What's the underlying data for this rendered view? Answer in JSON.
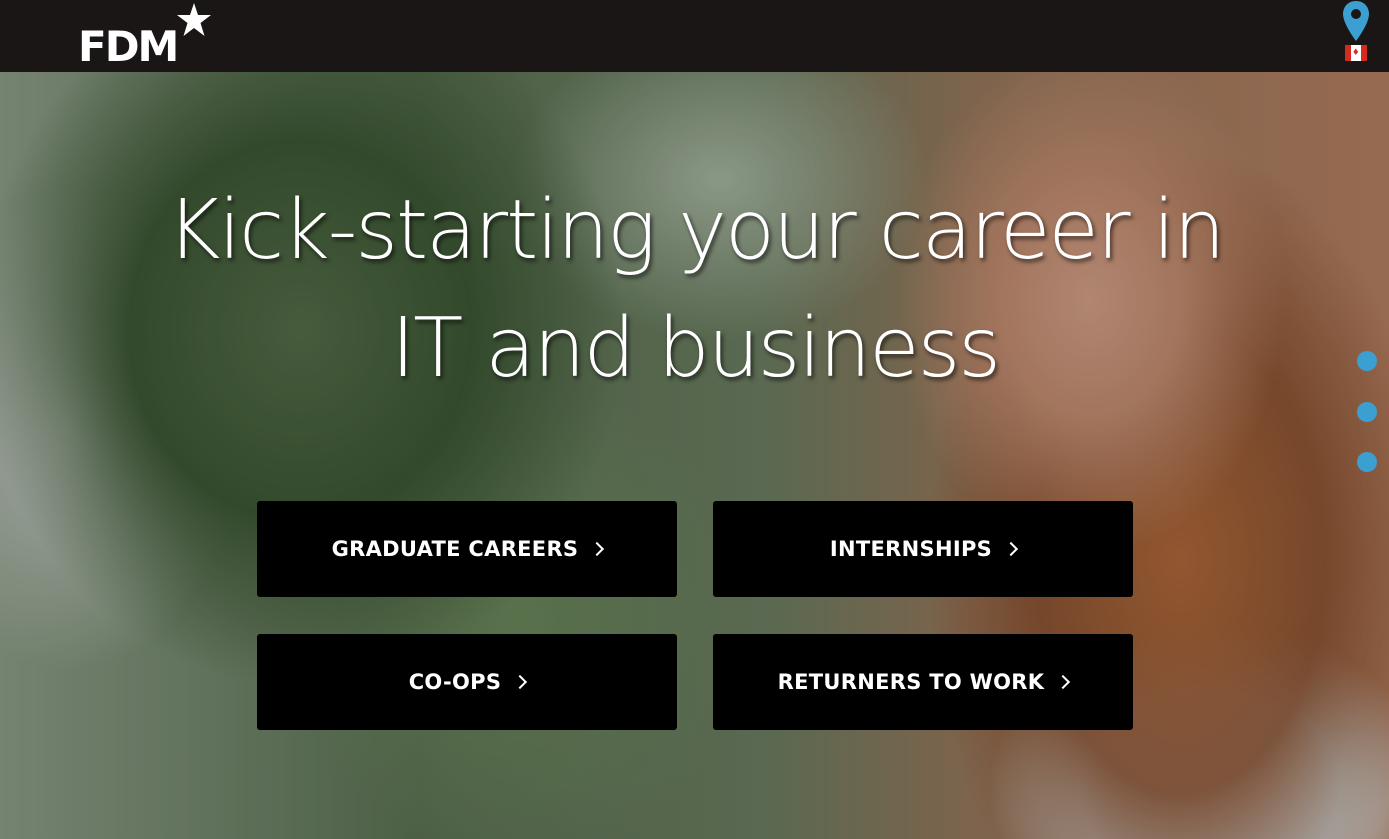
{
  "header": {
    "logo_text": "FDM",
    "location_icon": "location-pin-icon",
    "country_flag": "canada-flag-icon"
  },
  "hero": {
    "headline_line1": "Kick-starting your career in",
    "headline_line2": "IT and business"
  },
  "ctas": [
    {
      "label": "GRADUATE CAREERS"
    },
    {
      "label": "INTERNSHIPS"
    },
    {
      "label": "CO-OPS"
    },
    {
      "label": "RETURNERS TO WORK"
    }
  ],
  "colors": {
    "header_bg": "#1a1616",
    "button_bg": "#000000",
    "accent_blue": "#3b9fd2"
  }
}
